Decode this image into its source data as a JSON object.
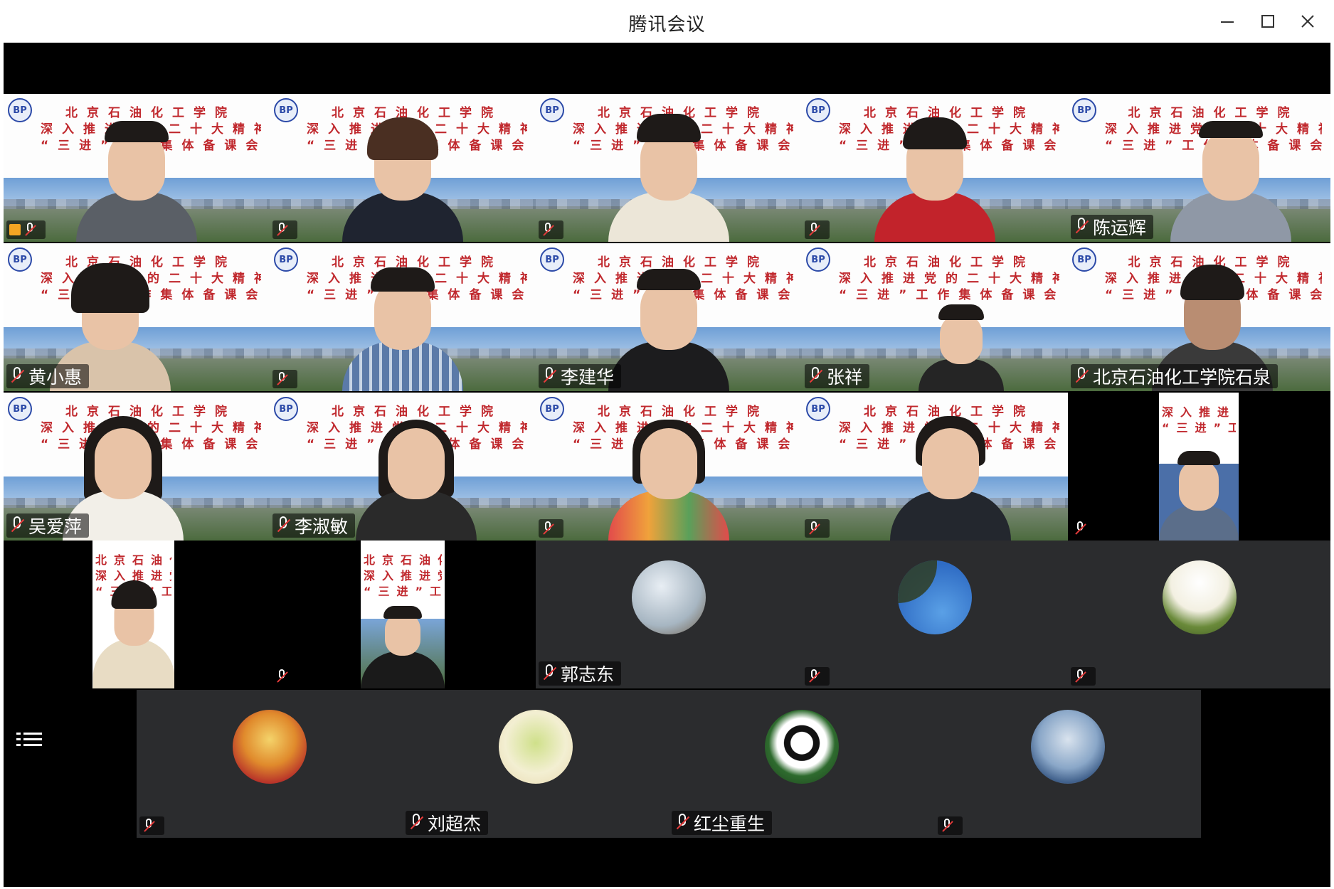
{
  "window": {
    "title": "腾讯会议"
  },
  "banner": {
    "line1": "北京石油化工学院",
    "line2": "深入推进党的二十大精神",
    "line3": "“三进”工作集体备课会"
  },
  "participants": {
    "r1c1": "",
    "r1c2": "",
    "r1c3": "",
    "r1c4": "",
    "r1c5": "陈运辉",
    "r2c1": "黄小惠",
    "r2c2": "",
    "r2c3": "李建华",
    "r2c4": "张祥",
    "r2c5": "北京石油化工学院石泉",
    "r3c1": "吴爱萍",
    "r3c2": "李淑敏",
    "r3c3": "",
    "r3c4": "",
    "r3c5": "",
    "r4c1": "",
    "r4c2": "",
    "r4c3": "郭志东",
    "r4c4": "",
    "r4c5": "",
    "r5c1": "",
    "r5c2": "刘超杰",
    "r5c3": "红尘重生",
    "r5c4": ""
  },
  "icons": {
    "minimize": "minimize-icon",
    "maximize": "maximize-icon",
    "close": "close-icon",
    "mic_muted": "mic-muted-icon",
    "layout": "grid-layout-icon"
  },
  "colors": {
    "banner_text": "#c0282d",
    "tile_dark": "#2b2c2e",
    "stage": "#000000"
  }
}
